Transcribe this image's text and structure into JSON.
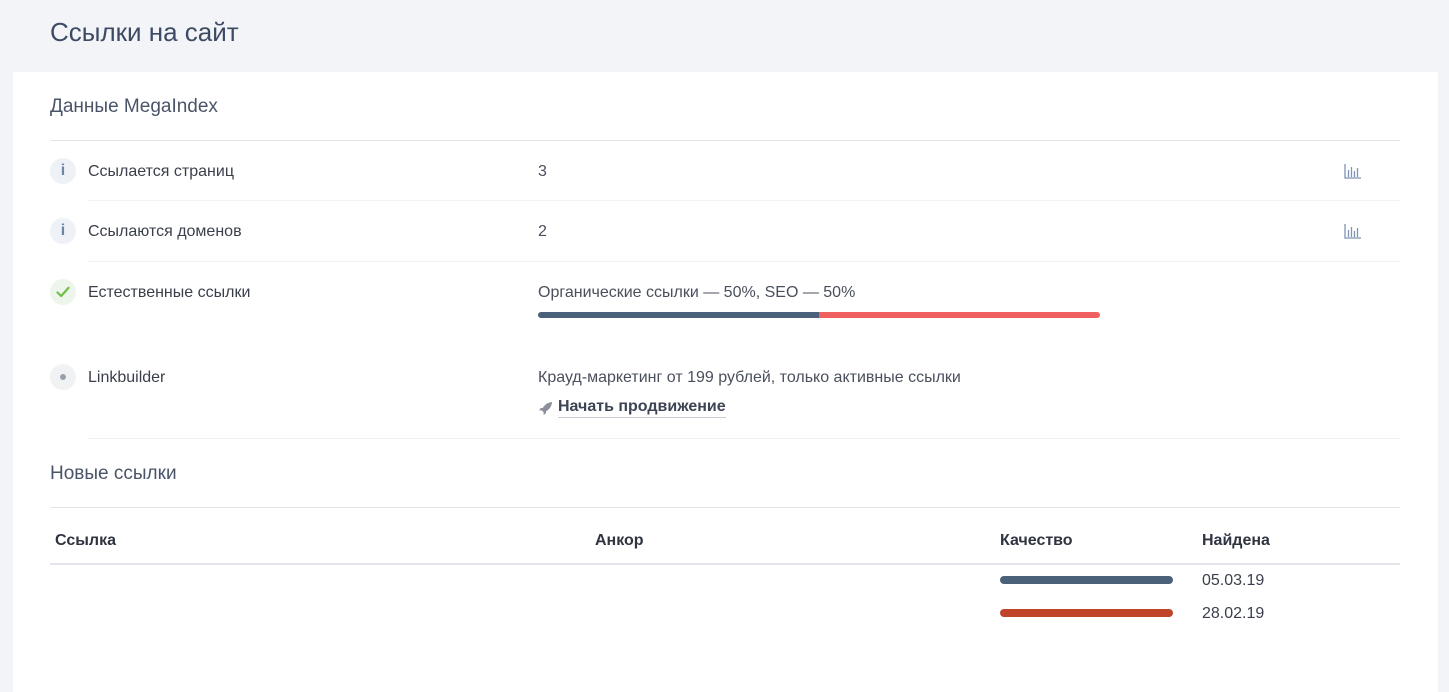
{
  "page": {
    "title": "Ссылки на сайт"
  },
  "megaindex": {
    "title": "Данные MegaIndex",
    "rows": [
      {
        "icon": "info-icon",
        "label": "Ссылается страниц",
        "value": "3",
        "action_icon": "bar-chart-icon"
      },
      {
        "icon": "info-icon",
        "label": "Ссылаются доменов",
        "value": "2",
        "action_icon": "bar-chart-icon"
      },
      {
        "icon": "check-icon",
        "label": "Естественные ссылки",
        "value": "Органические ссылки — 50%, SEO — 50%",
        "organic_percent": 50,
        "seo_percent": 50,
        "organic_color": "#4a6179",
        "seo_color": "#f06060"
      },
      {
        "icon": "dot-icon",
        "label": "Linkbuilder",
        "value": "Крауд-маркетинг от 199 рублей, только активные ссылки",
        "action_label": "Начать продвижение",
        "action_icon": "rocket-icon"
      }
    ]
  },
  "new_links": {
    "title": "Новые ссылки",
    "columns": [
      "Ссылка",
      "Анкор",
      "Качество",
      "Найдена"
    ],
    "rows": [
      {
        "link": "",
        "anchor": "",
        "quality_color": "#4a6179",
        "found": "05.03.19"
      },
      {
        "link": "",
        "anchor": "",
        "quality_color": "#c0442a",
        "found": "28.02.19"
      }
    ]
  }
}
